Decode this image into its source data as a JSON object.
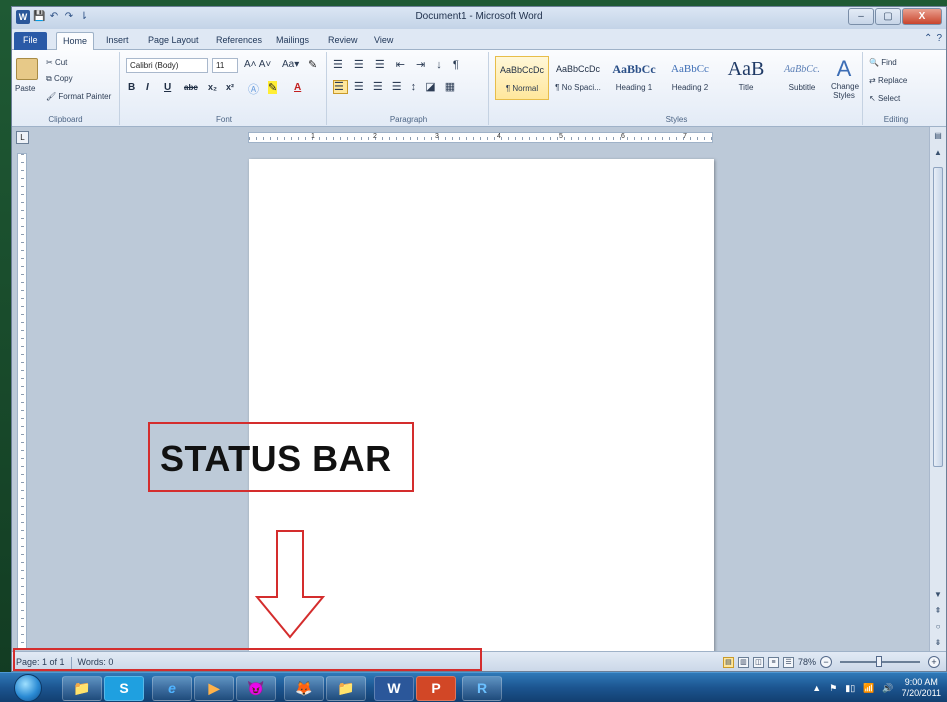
{
  "window": {
    "title": "Document1 - Microsoft Word",
    "app_icon_letter": "W",
    "buttons": [
      "–",
      "▢",
      "X"
    ]
  },
  "quick_access": [
    "💾",
    "↶",
    "↷",
    "⇂"
  ],
  "tabs": [
    "File",
    "Home",
    "Insert",
    "Page Layout",
    "References",
    "Mailings",
    "Review",
    "View"
  ],
  "clipboard": {
    "paste": "Paste",
    "cut": "Cut",
    "copy": "Copy",
    "format_painter": "Format Painter",
    "label": "Clipboard"
  },
  "font": {
    "family": "Calibri (Body)",
    "size": "11",
    "label": "Font",
    "buttons": [
      "B",
      "I",
      "U",
      "abc",
      "x₂",
      "x²",
      "A"
    ]
  },
  "paragraph": {
    "label": "Paragraph"
  },
  "styles": {
    "label": "Styles",
    "items": [
      {
        "sample": "AaBbCcDc",
        "name": "¶ Normal"
      },
      {
        "sample": "AaBbCcDc",
        "name": "¶ No Spaci..."
      },
      {
        "sample": "AaBbCc",
        "name": "Heading 1"
      },
      {
        "sample": "AaBbCc",
        "name": "Heading 2"
      },
      {
        "sample": "AaB",
        "name": "Title"
      },
      {
        "sample": "AaBbCc.",
        "name": "Subtitle"
      }
    ],
    "change_styles": "Change Styles"
  },
  "editing": {
    "label": "Editing",
    "find": "Find",
    "replace": "Replace",
    "select": "Select"
  },
  "ruler": {
    "numbers": [
      "1",
      "2",
      "3",
      "4",
      "5",
      "6",
      "7"
    ],
    "corner": "L"
  },
  "statusbar": {
    "page": "Page: 1 of 1",
    "words": "Words: 0",
    "zoom": "78%"
  },
  "annotation": {
    "text": "STATUS BAR"
  },
  "taskbar": {
    "apps": [
      "📁",
      "S",
      "e",
      "▶",
      "😈",
      "🦊",
      "📁",
      "W",
      "P",
      "R"
    ],
    "time": "9:00 AM",
    "date": "7/20/2011"
  },
  "colors": {
    "accent_red": "#d42d2d",
    "file_tab": "#2a5aa7",
    "page": "#ffffff"
  }
}
